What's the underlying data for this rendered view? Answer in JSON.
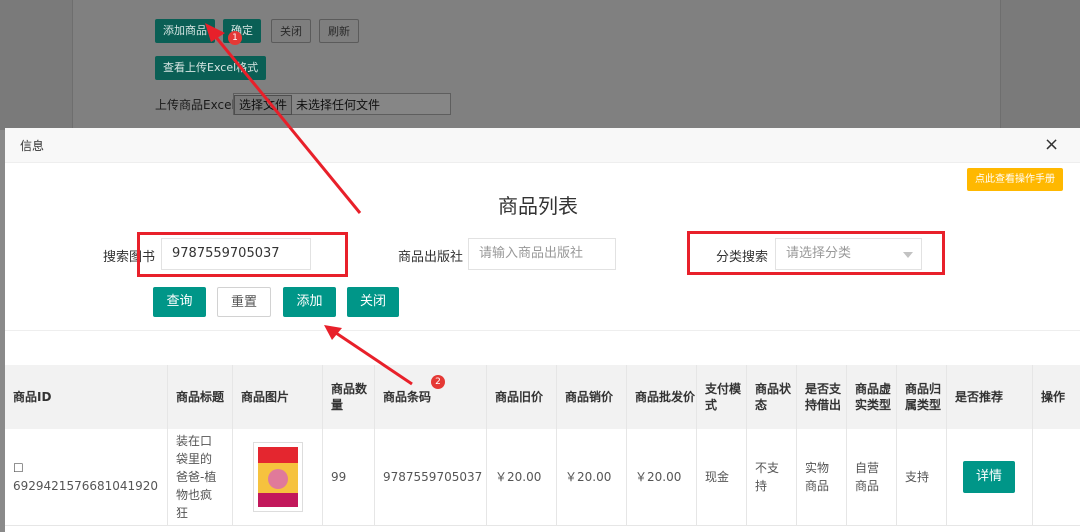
{
  "background": {
    "add_product": "添加商品",
    "confirm": "确定",
    "close": "关闭",
    "refresh": "刷新",
    "view_excel_format": "查看上传Excel格式",
    "upload_label": "上传商品Excel",
    "choose_file": "选择文件",
    "no_file": "未选择任何文件"
  },
  "modal": {
    "title": "信息",
    "close_glyph": "×",
    "manual_button": "点此查看操作手册",
    "list_title": "商品列表"
  },
  "filters": {
    "search_book_label": "搜索图书",
    "search_book_value": "9787559705037",
    "publisher_label": "商品出版社",
    "publisher_placeholder": "请输入商品出版社",
    "category_label": "分类搜索",
    "category_placeholder": "请选择分类"
  },
  "actions": {
    "query": "查询",
    "reset": "重置",
    "add": "添加",
    "close": "关闭"
  },
  "table": {
    "columns": [
      "商品ID",
      "商品标题",
      "商品图片",
      "商品数量",
      "商品条码",
      "商品旧价",
      "商品销价",
      "商品批发价",
      "支付模式",
      "商品状态",
      "是否支持借出",
      "商品虚实类型",
      "商品归属类型",
      "是否推荐",
      "操作"
    ],
    "rows": [
      {
        "checkbox": "☐",
        "id": "6929421576681041920",
        "title": "装在口袋里的爸爸-植物也疯狂",
        "quantity": "99",
        "barcode": "9787559705037",
        "old_price": "￥20.00",
        "sale_price": "￥20.00",
        "wholesale_price": "￥20.00",
        "pay_mode": "现金",
        "status": "不支持",
        "lendable": "实物商品",
        "virtual_type": "自营商品",
        "ownership": "支持",
        "detail_button": "详情"
      }
    ]
  },
  "annotations": {
    "badge_1": "1",
    "badge_2": "2",
    "arrow_color": "#e8202a"
  }
}
